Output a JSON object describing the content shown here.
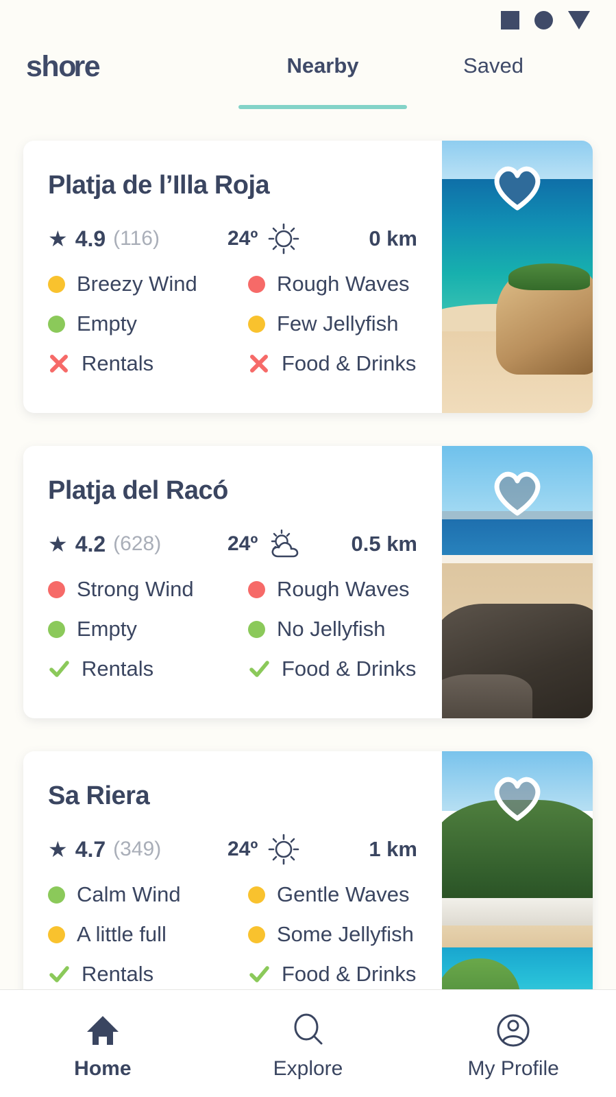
{
  "status_bar": {
    "icons": [
      "square-icon",
      "circle-icon",
      "triangle-down-icon"
    ]
  },
  "header": {
    "logo_part1": "sh",
    "logo_part2": "o",
    "logo_part3": "re",
    "logo_text": "shore",
    "tabs": [
      {
        "label": "Nearby",
        "active": true
      },
      {
        "label": "Saved",
        "active": false
      }
    ]
  },
  "colors": {
    "accent_teal": "#83d3c8",
    "navy": "#3a4560",
    "yellow": "#f9c22e",
    "green": "#8bc95a",
    "red": "#f66a68",
    "muted_gray": "#a9aeb8",
    "background": "#fdfcf7"
  },
  "beaches": [
    {
      "name": "Platja de l’Illa Roja",
      "rating": "4.9",
      "review_count": "(116)",
      "temperature": "24º",
      "weather_icon": "sun-icon",
      "distance": "0 km",
      "saved": true,
      "heart_icon": "heart-filled-icon",
      "attributes": [
        {
          "label": "Breezy Wind",
          "marker": "dot",
          "color": "#f9c22e",
          "icon": "dot-yellow-icon"
        },
        {
          "label": "Rough Waves",
          "marker": "dot",
          "color": "#f66a68",
          "icon": "dot-red-icon"
        },
        {
          "label": "Empty",
          "marker": "dot",
          "color": "#8bc95a",
          "icon": "dot-green-icon"
        },
        {
          "label": "Few Jellyfish",
          "marker": "dot",
          "color": "#f9c22e",
          "icon": "dot-yellow-icon"
        },
        {
          "label": "Rentals",
          "marker": "cross",
          "color": "#f66a68",
          "icon": "cross-icon"
        },
        {
          "label": "Food & Drinks",
          "marker": "cross",
          "color": "#f66a68",
          "icon": "cross-icon"
        }
      ]
    },
    {
      "name": "Platja del Racó",
      "rating": "4.2",
      "review_count": "(628)",
      "temperature": "24º",
      "weather_icon": "partly-cloudy-icon",
      "distance": "0.5 km",
      "saved": false,
      "heart_icon": "heart-outline-icon",
      "attributes": [
        {
          "label": "Strong Wind",
          "marker": "dot",
          "color": "#f66a68",
          "icon": "dot-red-icon"
        },
        {
          "label": "Rough Waves",
          "marker": "dot",
          "color": "#f66a68",
          "icon": "dot-red-icon"
        },
        {
          "label": "Empty",
          "marker": "dot",
          "color": "#8bc95a",
          "icon": "dot-green-icon"
        },
        {
          "label": "No Jellyfish",
          "marker": "dot",
          "color": "#8bc95a",
          "icon": "dot-green-icon"
        },
        {
          "label": "Rentals",
          "marker": "check",
          "color": "#8bc95a",
          "icon": "check-icon"
        },
        {
          "label": "Food & Drinks",
          "marker": "check",
          "color": "#8bc95a",
          "icon": "check-icon"
        }
      ]
    },
    {
      "name": "Sa Riera",
      "rating": "4.7",
      "review_count": "(349)",
      "temperature": "24º",
      "weather_icon": "sun-icon",
      "distance": "1 km",
      "saved": false,
      "heart_icon": "heart-outline-icon",
      "attributes": [
        {
          "label": "Calm Wind",
          "marker": "dot",
          "color": "#8bc95a",
          "icon": "dot-green-icon"
        },
        {
          "label": "Gentle Waves",
          "marker": "dot",
          "color": "#f9c22e",
          "icon": "dot-yellow-icon"
        },
        {
          "label": "A little full",
          "marker": "dot",
          "color": "#f9c22e",
          "icon": "dot-yellow-icon"
        },
        {
          "label": "Some Jellyfish",
          "marker": "dot",
          "color": "#f9c22e",
          "icon": "dot-yellow-icon"
        },
        {
          "label": "Rentals",
          "marker": "check",
          "color": "#8bc95a",
          "icon": "check-icon"
        },
        {
          "label": "Food & Drinks",
          "marker": "check",
          "color": "#8bc95a",
          "icon": "check-icon"
        }
      ]
    }
  ],
  "bottom_nav": [
    {
      "label": "Home",
      "icon": "home-icon",
      "active": true
    },
    {
      "label": "Explore",
      "icon": "search-icon",
      "active": false
    },
    {
      "label": "My Profile",
      "icon": "profile-icon",
      "active": false
    }
  ]
}
